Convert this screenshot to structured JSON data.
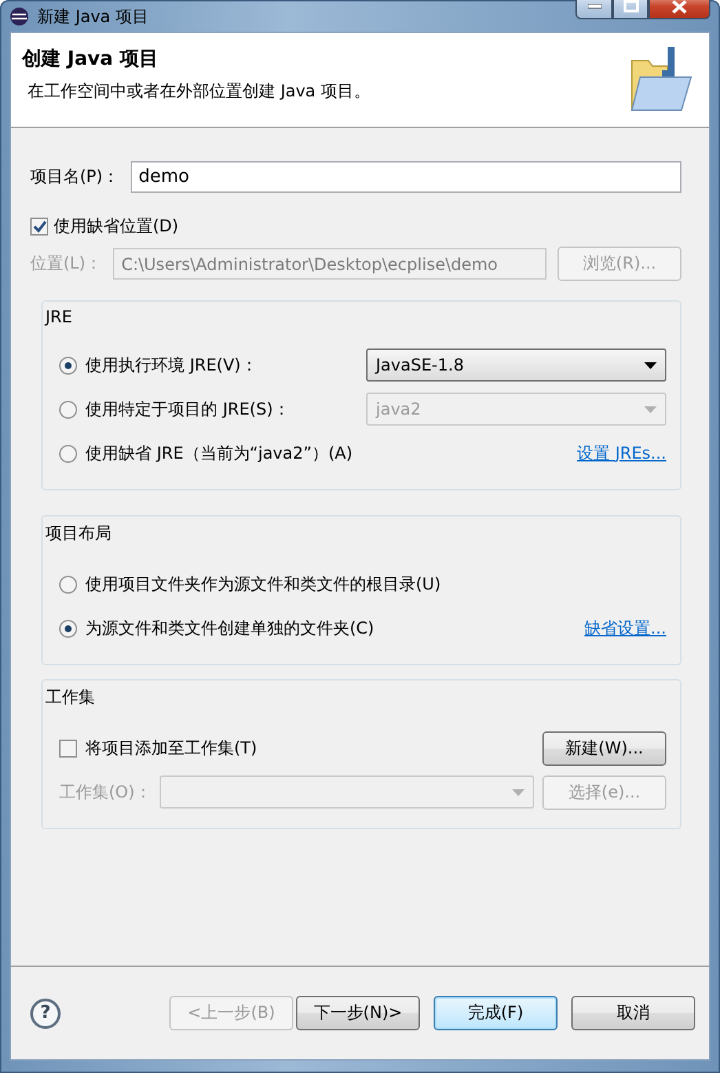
{
  "window": {
    "title": "新建 Java 项目"
  },
  "header": {
    "title": "创建 Java 项目",
    "description": "在工作空间中或者在外部位置创建 Java 项目。"
  },
  "project_name": {
    "label": "项目名(P)：",
    "value": "demo"
  },
  "use_default_location": {
    "label": "使用缺省位置(D)",
    "checked": true
  },
  "location": {
    "label": "位置(L)：",
    "value": "C:\\Users\\Administrator\\Desktop\\ecplise\\demo",
    "disabled": true,
    "browse": "浏览(R)..."
  },
  "jre": {
    "title": "JRE",
    "options": [
      {
        "kind": "combo",
        "label": "使用执行环境 JRE(V)：",
        "selected": true,
        "value": "JavaSE-1.8",
        "disabled": false
      },
      {
        "kind": "combo",
        "label": "使用特定于项目的 JRE(S)：",
        "selected": false,
        "value": "java2",
        "disabled": true
      },
      {
        "kind": "link",
        "label": "使用缺省 JRE（当前为“java2”）(A)",
        "selected": false,
        "link": "设置 JREs..."
      }
    ]
  },
  "layout": {
    "title": "项目布局",
    "options": [
      {
        "kind": "plain",
        "label": "使用项目文件夹作为源文件和类文件的根目录(U)",
        "selected": false
      },
      {
        "kind": "link",
        "label": "为源文件和类文件创建单独的文件夹(C)",
        "selected": true,
        "link": "缺省设置..."
      }
    ]
  },
  "working_sets": {
    "title": "工作集",
    "add": {
      "label": "将项目添加至工作集(T)",
      "checked": false
    },
    "new_button": "新建(W)...",
    "field_label": "工作集(O)：",
    "disabled": true,
    "select_button": "选择(e)..."
  },
  "footer": {
    "help": "?",
    "buttons": [
      {
        "label": "<上一步(B)",
        "disabled": true,
        "default": false
      },
      {
        "label": "下一步(N)>",
        "disabled": false,
        "default": false
      },
      {
        "label": "完成(F)",
        "disabled": false,
        "default": true
      },
      {
        "label": "取消",
        "disabled": false,
        "default": false
      }
    ]
  }
}
